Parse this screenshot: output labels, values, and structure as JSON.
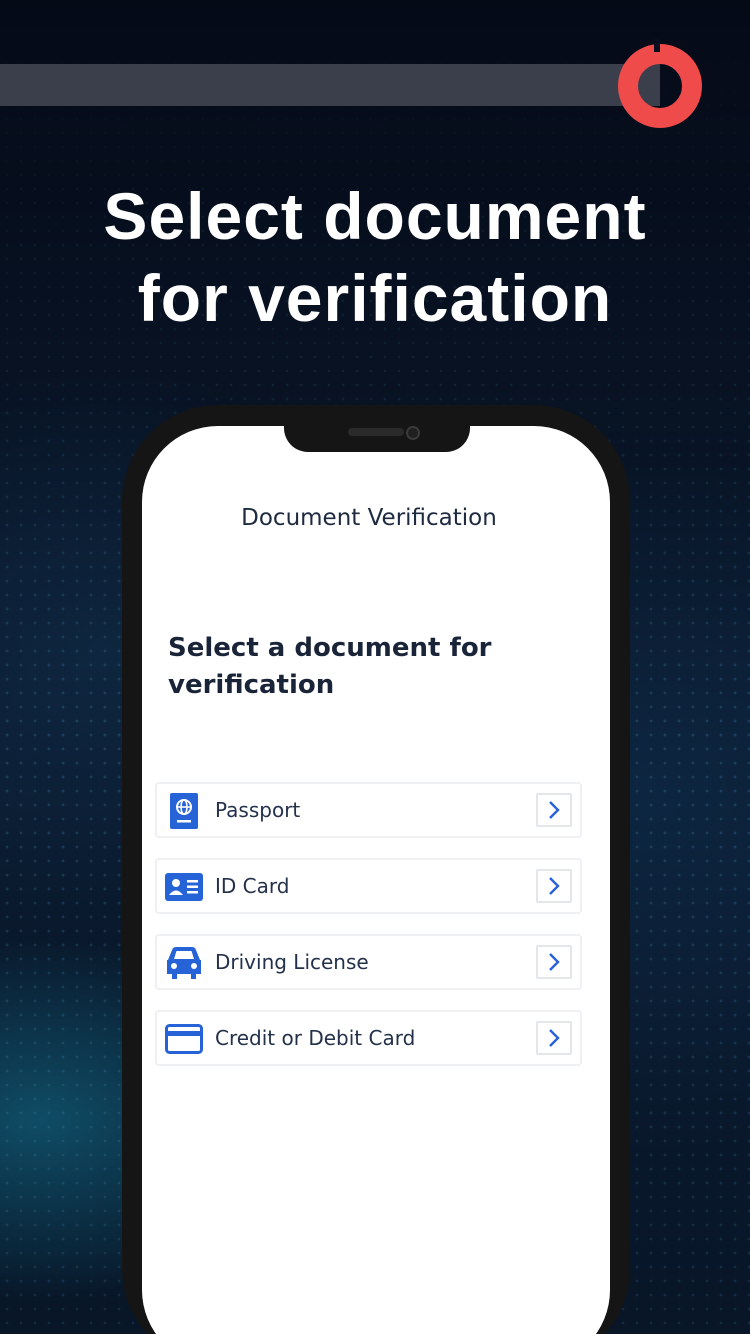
{
  "headline": {
    "line1": "Select document",
    "line2": "for verification"
  },
  "app": {
    "title": "Document Verification",
    "prompt": "Select a document for verification"
  },
  "documents": [
    {
      "label": "Passport",
      "icon": "passport-icon"
    },
    {
      "label": "ID Card",
      "icon": "id-card-icon"
    },
    {
      "label": "Driving License",
      "icon": "car-icon"
    },
    {
      "label": "Credit or Debit Card",
      "icon": "credit-card-icon"
    }
  ],
  "colors": {
    "accent": "#2563d6",
    "brand": "#ef4b4b",
    "background": "#070d1c",
    "text_dark": "#1a2438"
  },
  "icons": {
    "brand": "brand-logo-icon",
    "chevron": "chevron-right-icon"
  }
}
